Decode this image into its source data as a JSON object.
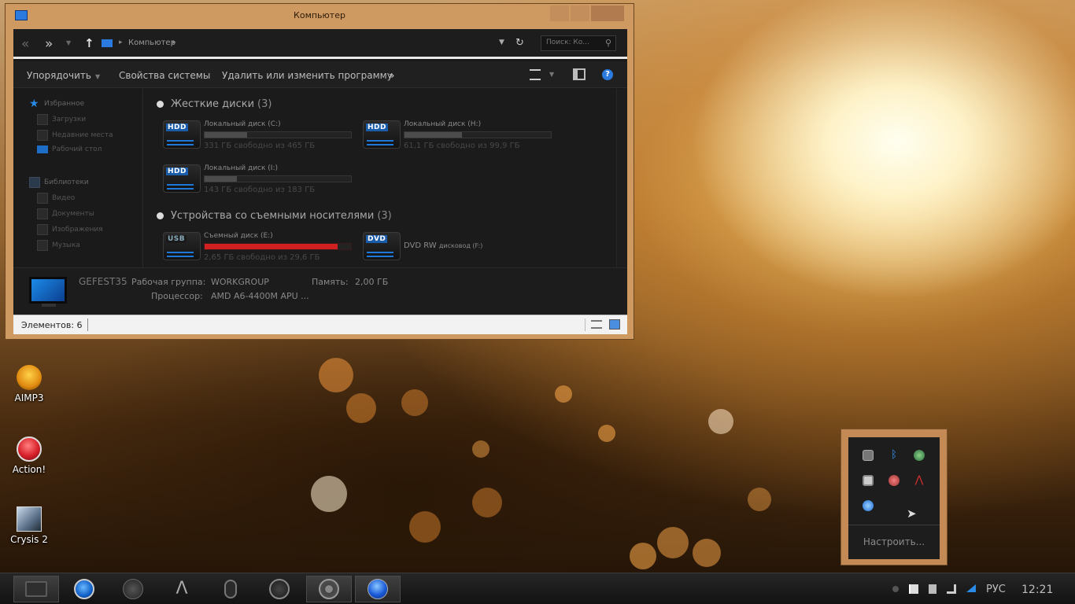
{
  "window": {
    "title": "Компьютер",
    "address": {
      "location": "Компьютер"
    },
    "search": {
      "placeholder": "Поиск: Ко..."
    },
    "toolbar": {
      "organize": "Упорядочить",
      "system_properties": "Свойства системы",
      "uninstall": "Удалить или изменить программу",
      "more": "»"
    },
    "sidebar": {
      "favorites": {
        "label": "Избранное",
        "items": [
          "Загрузки",
          "Недавние места",
          "Рабочий стол"
        ]
      },
      "libraries": {
        "label": "Библиотеки",
        "items": [
          "Видео",
          "Документы",
          "Изображения",
          "Музыка"
        ]
      }
    },
    "groups": {
      "hard_disks": {
        "label": "Жесткие диски",
        "count": "(3)"
      },
      "removable": {
        "label": "Устройства со съемными носителями",
        "count": "(3)"
      }
    },
    "drives": {
      "c": {
        "name": "Локальный диск (C:)",
        "free": "331 ГБ свободно из 465 ГБ",
        "used_fraction": 0.29,
        "badge": "HDD"
      },
      "h": {
        "name": "Локальный диск (H:)",
        "free": "61,1 ГБ свободно из 99,9 ГБ",
        "used_fraction": 0.39,
        "badge": "HDD"
      },
      "i": {
        "name": "Локальный диск (I:)",
        "free": "143 ГБ свободно из 183 ГБ",
        "used_fraction": 0.22,
        "badge": "HDD"
      },
      "e": {
        "name": "Съемный диск (E:)",
        "free": "2,65 ГБ свободно из 29,6 ГБ",
        "used_fraction": 0.91,
        "badge": "USB"
      },
      "f": {
        "name": "DVD RW",
        "name_small": "дисковод (F:)",
        "badge": "DVD"
      }
    },
    "details": {
      "computer_name": "GEFEST35",
      "workgroup_label": "Рабочая группа:",
      "workgroup_value": "WORKGROUP",
      "memory_label": "Память:",
      "memory_value": "2,00 ГБ",
      "cpu_label": "Процессор:",
      "cpu_value": "AMD A6-4400M APU ..."
    },
    "status": {
      "items_count": "Элементов: 6"
    }
  },
  "desktop": {
    "icons": [
      {
        "label": "AIMP3",
        "icon": "aimp-icon",
        "color": "#f3a11a"
      },
      {
        "label": "Action!",
        "icon": "action-icon",
        "color": "#d8202a"
      },
      {
        "label": "Crysis 2",
        "icon": "crysis-icon",
        "color": "#8aa0b8"
      }
    ]
  },
  "tray_popup": {
    "icons": [
      "usb-safe-remove-icon",
      "bluetooth-icon",
      "globe-icon",
      "display-icon",
      "usb-device-icon",
      "chart-icon",
      "update-icon"
    ],
    "configure": "Настроить..."
  },
  "taskbar": {
    "apps": [
      "file-explorer-icon",
      "media-player-icon",
      "steam-icon",
      "amd-icon",
      "mouse-icon",
      "utorrent-icon",
      "chrome-icon",
      "blue-orb-icon"
    ],
    "language": "РУС",
    "time": "12:21"
  },
  "colors": {
    "window_frame": "#cf9a62",
    "accent_blue": "#1e78d8",
    "usage_red": "#d02020"
  }
}
